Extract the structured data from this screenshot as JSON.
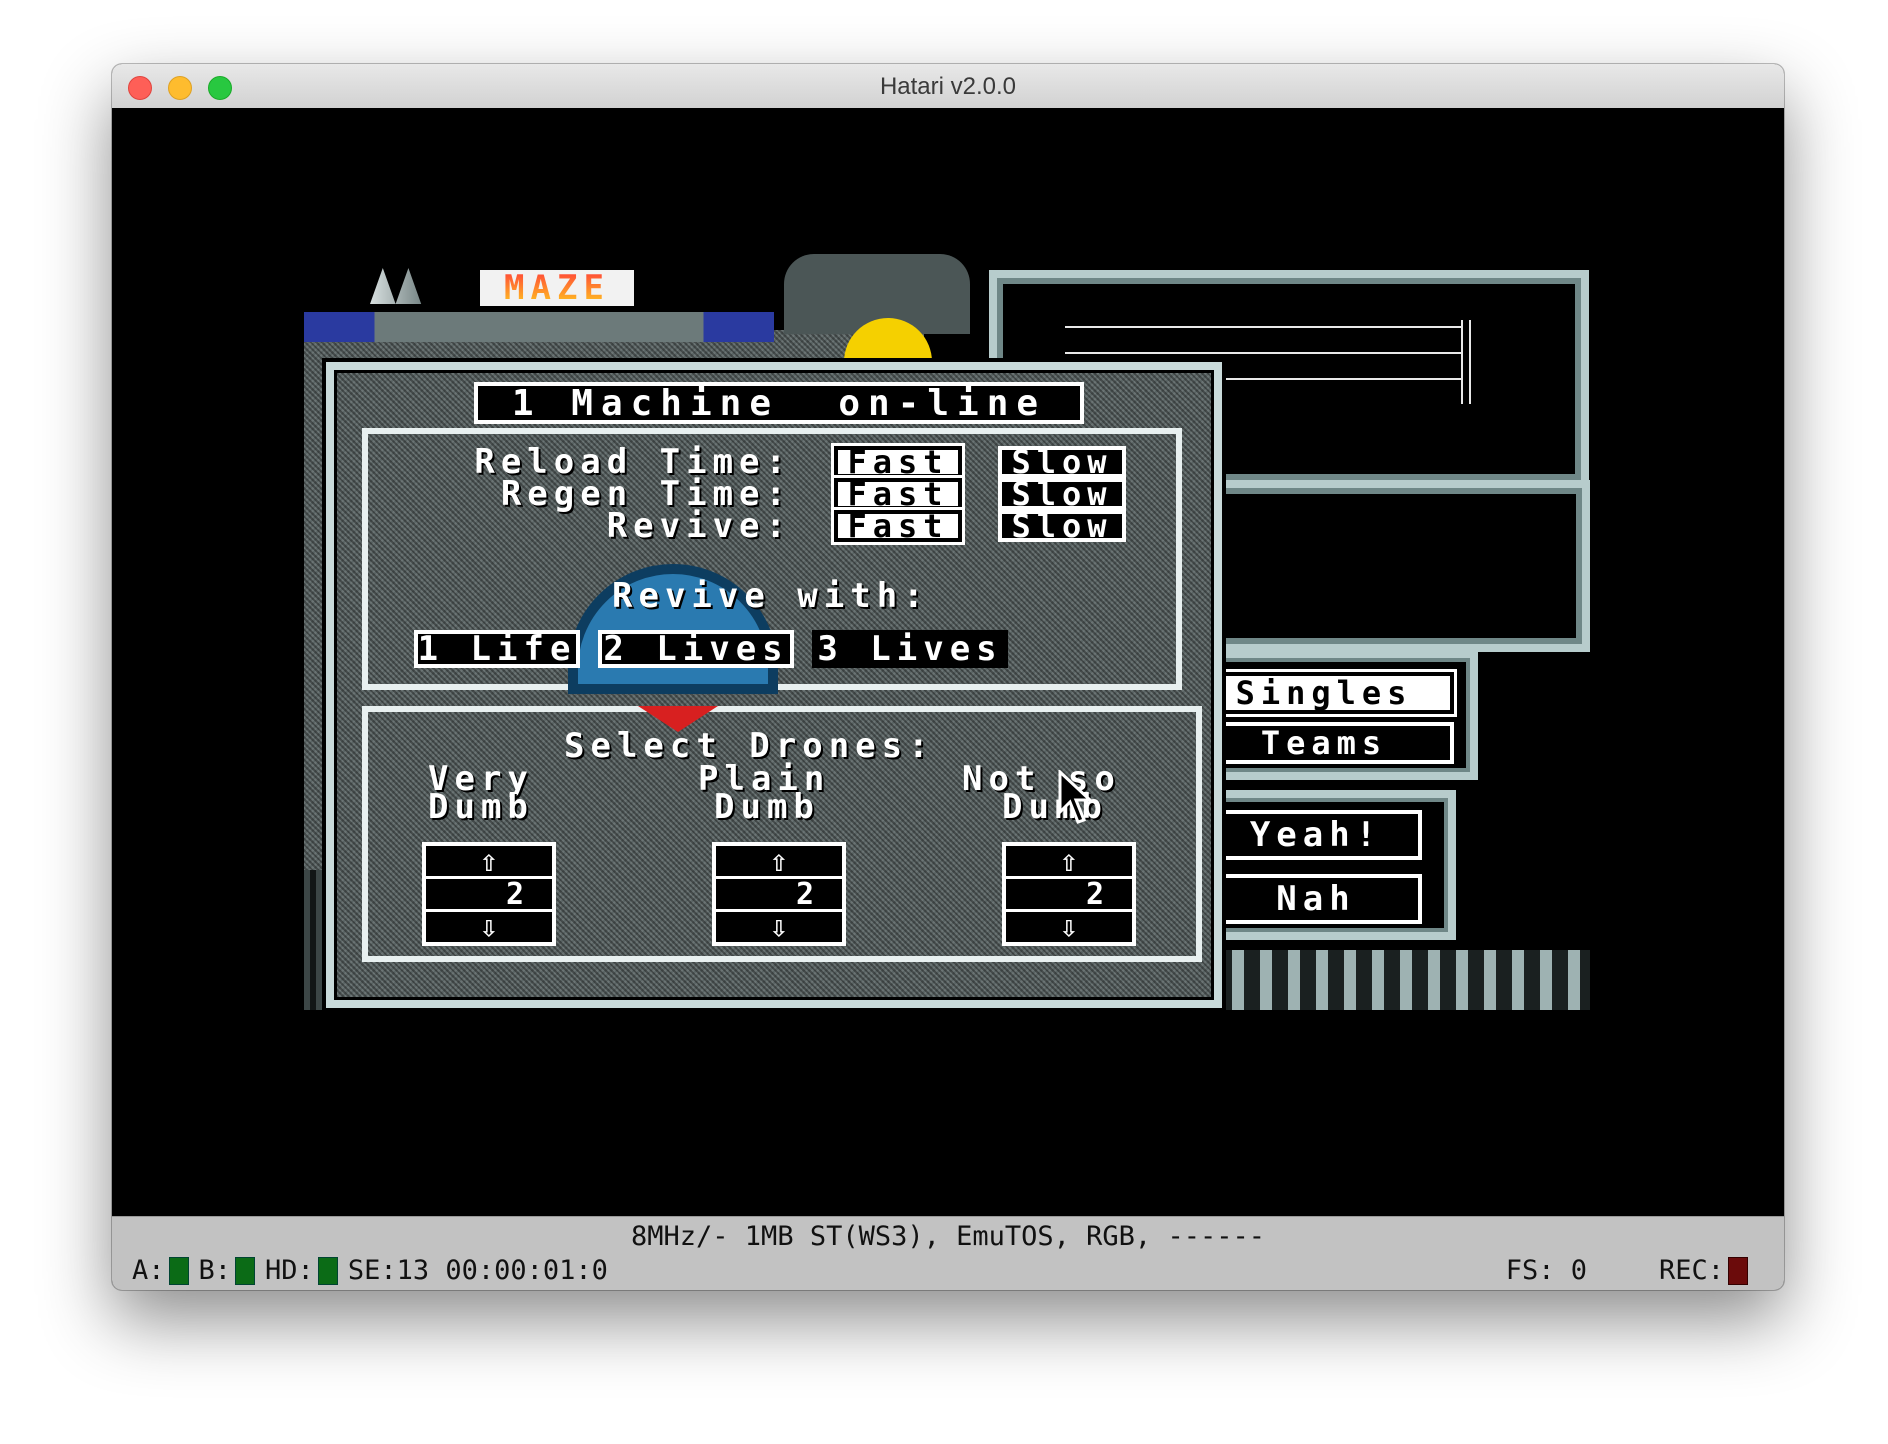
{
  "window": {
    "title": "Hatari v2.0.0"
  },
  "game": {
    "logo": "MAZE",
    "dialog": {
      "heading": "1 Machine  on-line",
      "settings": [
        {
          "label": "Reload Time:",
          "fast": "Fast",
          "slow": "Slow"
        },
        {
          "label": "Regen Time:",
          "fast": "Fast",
          "slow": "Slow"
        },
        {
          "label": "Revive:",
          "fast": "Fast",
          "slow": "Slow"
        }
      ],
      "revive_with_label": "Revive with:",
      "lives": [
        "1 Life",
        "2 Lives",
        "3 Lives"
      ],
      "drones_heading": "Select Drones:",
      "drones": [
        {
          "label_top": "Very",
          "label_bottom": "Dumb",
          "up": "⇧",
          "value": "2",
          "down": "⇩"
        },
        {
          "label_top": "Plain",
          "label_bottom": "Dumb",
          "up": "⇧",
          "value": "2",
          "down": "⇩"
        },
        {
          "label_top": "Not so",
          "label_bottom": "Dumb",
          "up": "⇧",
          "value": "2",
          "down": "⇩"
        }
      ]
    },
    "mode": {
      "singles": "Singles",
      "teams": "Teams"
    },
    "confirm": {
      "yes": "Yeah!",
      "no": "Nah"
    }
  },
  "status": {
    "line1": "8MHz/- 1MB ST(WS3), EmuTOS, RGB, ------",
    "drive_a": "A:",
    "drive_b": "B:",
    "hd": "HD:",
    "se": "SE:13",
    "time": "00:00:01:0",
    "fs": "FS: 0",
    "rec": "REC:"
  }
}
